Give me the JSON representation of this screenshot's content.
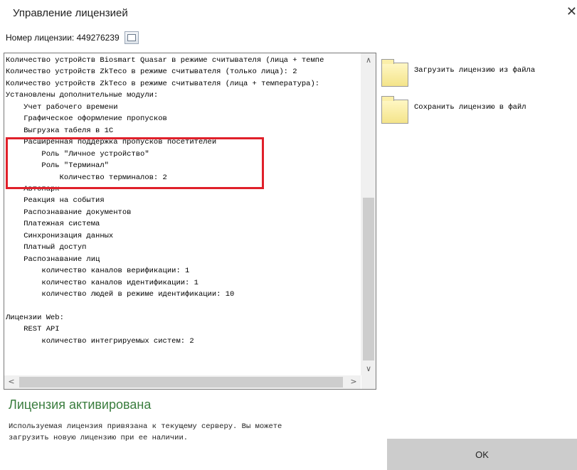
{
  "dialog": {
    "title": "Управление лицензией",
    "close_glyph": "✕"
  },
  "license": {
    "number_label": "Номер лицензии: 449276239",
    "copy_icon": "copy-icon"
  },
  "details_text": "Количество устройств Biosmart Quasar в режиме считывателя (лица + темпе\nКоличество устройств ZkTeco в режиме считывателя (только лица): 2\nКоличество устройств ZkTeco в режиме считывателя (лица + температура):\nУстановлены дополнительные модули:\n    Учет рабочего времени\n    Графическое оформление пропусков\n    Выгрузка табеля в 1С\n    Расширенная поддержка пропусков посетителей\n        Роль \"Личное устройство\"\n        Роль \"Терминал\"\n            Количество терминалов: 2\n    Автопарк\n    Реакция на события\n    Распознавание документов\n    Платежная система\n    Синхронизация данных\n    Платный доступ\n    Распознавание лиц\n        количество каналов верификации: 1\n        количество каналов идентификации: 1\n        количество людей в режиме идентификации: 10\n\nЛицензии Web:\n    REST API\n        количество интегрируемых систем: 2",
  "actions": {
    "load_label": "Загрузить лицензию из файла",
    "save_label": "Сохранить лицензию в файл",
    "folder_icon": "folder-icon"
  },
  "status": {
    "title": "Лицензия активирована",
    "description": "Используемая лицензия привязана к текущему серверу. Вы можете\nзагрузить новую лицензию при ее наличии."
  },
  "ok_label": "OK",
  "colors": {
    "highlight": "#e0202a",
    "status_green": "#3a7d3e",
    "ok_bg": "#cccccc"
  }
}
